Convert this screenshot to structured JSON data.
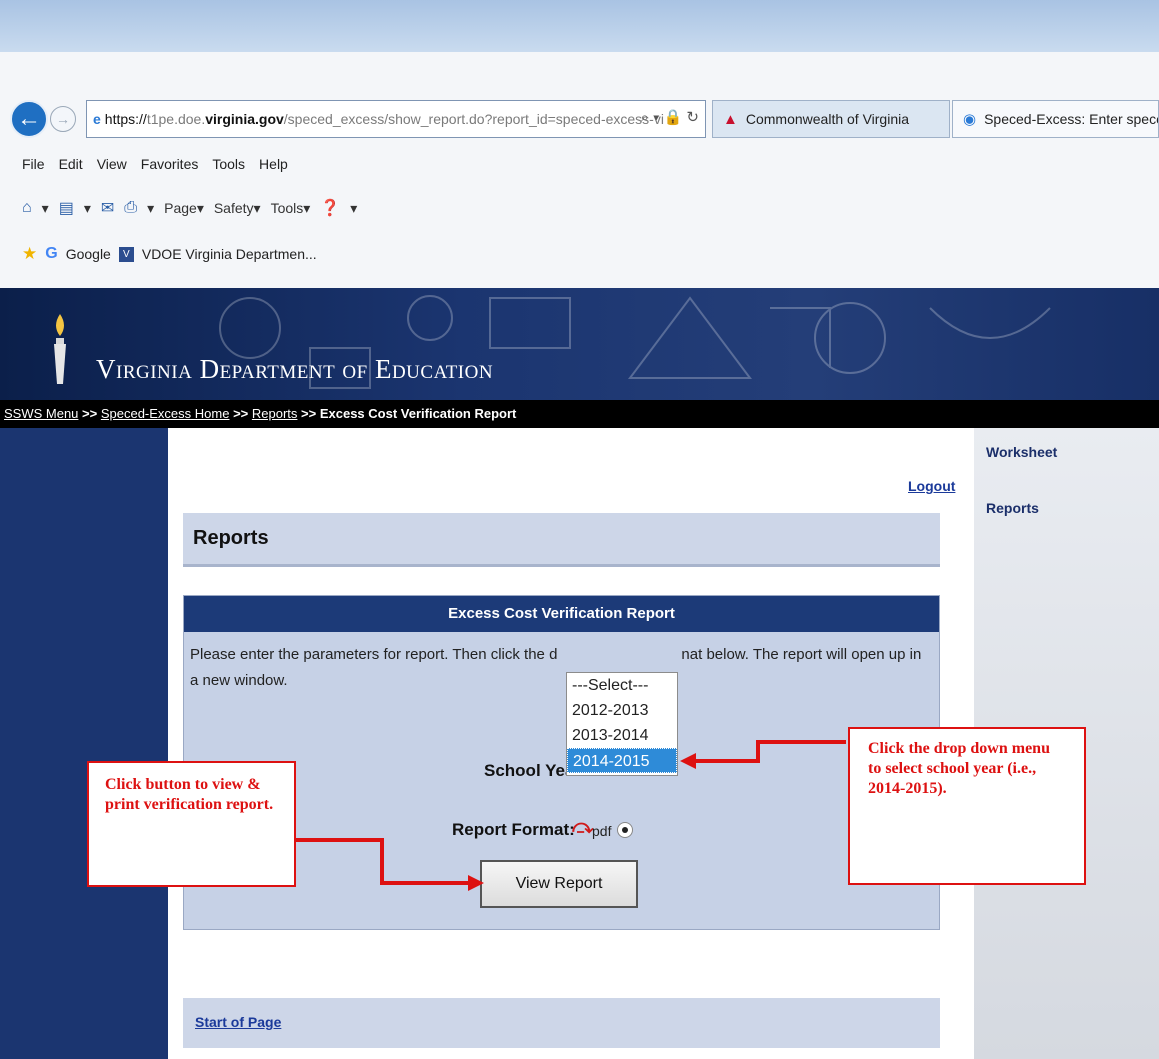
{
  "browser": {
    "url_protocol": "https://",
    "url_domain_prefix": "t1pe.doe.",
    "url_domain": "virginia.gov",
    "url_path": "/speced_excess/show_report.do?report_id=speced-excess-vi",
    "tabs": [
      {
        "label": "Commonwealth of Virginia"
      },
      {
        "label": "Speced-Excess: Enter spece..."
      }
    ],
    "menu": [
      "File",
      "Edit",
      "View",
      "Favorites",
      "Tools",
      "Help"
    ],
    "command_bar": {
      "page": "Page",
      "safety": "Safety",
      "tools": "Tools"
    },
    "favorites": [
      {
        "label": "Google"
      },
      {
        "label": "VDOE Virginia Departmen..."
      }
    ]
  },
  "banner": {
    "title": "Virginia Department of Education"
  },
  "breadcrumb": {
    "item1": "SSWS Menu",
    "sep": " >> ",
    "item2": "Speced-Excess Home",
    "item3": "Reports",
    "current": "Excess Cost Verification Report"
  },
  "sidebar": {
    "items": [
      {
        "label": "Worksheet"
      },
      {
        "label": "Reports"
      }
    ]
  },
  "main": {
    "logout": "Logout",
    "page_title": "Reports",
    "panel": {
      "title": "Excess Cost Verification Report",
      "instructions_left": "Please enter the parameters for report. Then click the d",
      "instructions_right": "nat below. The report will open up in a new window.",
      "school_year_label": "School Year:",
      "report_format_label": "Report Format:",
      "pdf_label": "pdf",
      "view_button": "View Report"
    },
    "school_year_options": [
      "---Select---",
      "2012-2013",
      "2013-2014",
      "2014-2015"
    ],
    "selected_school_year": "2014-2015",
    "start_of_page": "Start of Page"
  },
  "annotations": {
    "left": "Click button to view & print verification report.",
    "right": "Click the drop down menu to select school year (i.e., 2014-2015).",
    "color": "#dd1111"
  }
}
